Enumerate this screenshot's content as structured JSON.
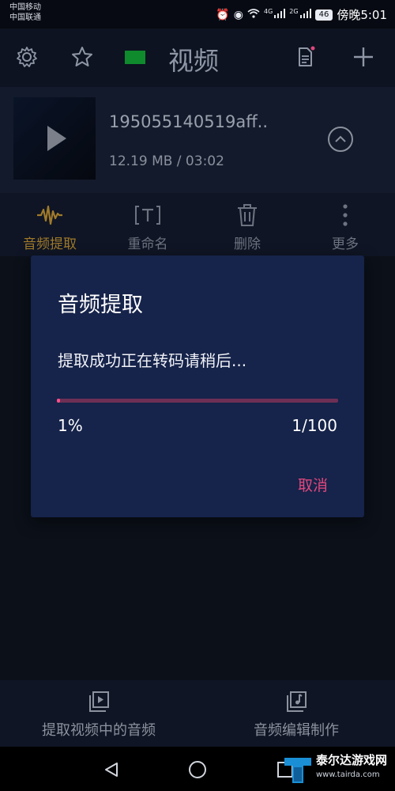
{
  "status_bar": {
    "carrier_1": "中国移动",
    "carrier_2": "中国联通",
    "battery": "46",
    "time": "傍晚5:01",
    "net_1": "4G",
    "net_2": "2G"
  },
  "header": {
    "title": "视频",
    "icons": [
      "gear-icon",
      "star-icon",
      "mail-icon",
      "document-icon",
      "plus-icon"
    ]
  },
  "media": {
    "filename": "195055140519aff..",
    "meta": "12.19 MB / 03:02"
  },
  "actions": [
    {
      "label": "音频提取",
      "icon": "waveform-icon",
      "active": true
    },
    {
      "label": "重命名",
      "icon": "rename-icon",
      "active": false
    },
    {
      "label": "删除",
      "icon": "trash-icon",
      "active": false
    },
    {
      "label": "更多",
      "icon": "more-icon",
      "active": false
    }
  ],
  "dialog": {
    "title": "音频提取",
    "message": "提取成功正在转码请稍后...",
    "progress_percent_label": "1%",
    "progress_fraction": 0.01,
    "count_label": "1/100",
    "cancel_label": "取消"
  },
  "bottom_tabs": [
    {
      "label": "提取视频中的音频",
      "icon": "video-extract-icon"
    },
    {
      "label": "音频编辑制作",
      "icon": "music-note-icon"
    }
  ],
  "watermark": {
    "text": "泰尔达游戏网",
    "url": "www.tairda.com"
  },
  "colors": {
    "accent": "#e0487d",
    "progress_fill": "#ff4f8a",
    "active_tab": "#a07a2a",
    "dialog_bg": "#16234a"
  }
}
